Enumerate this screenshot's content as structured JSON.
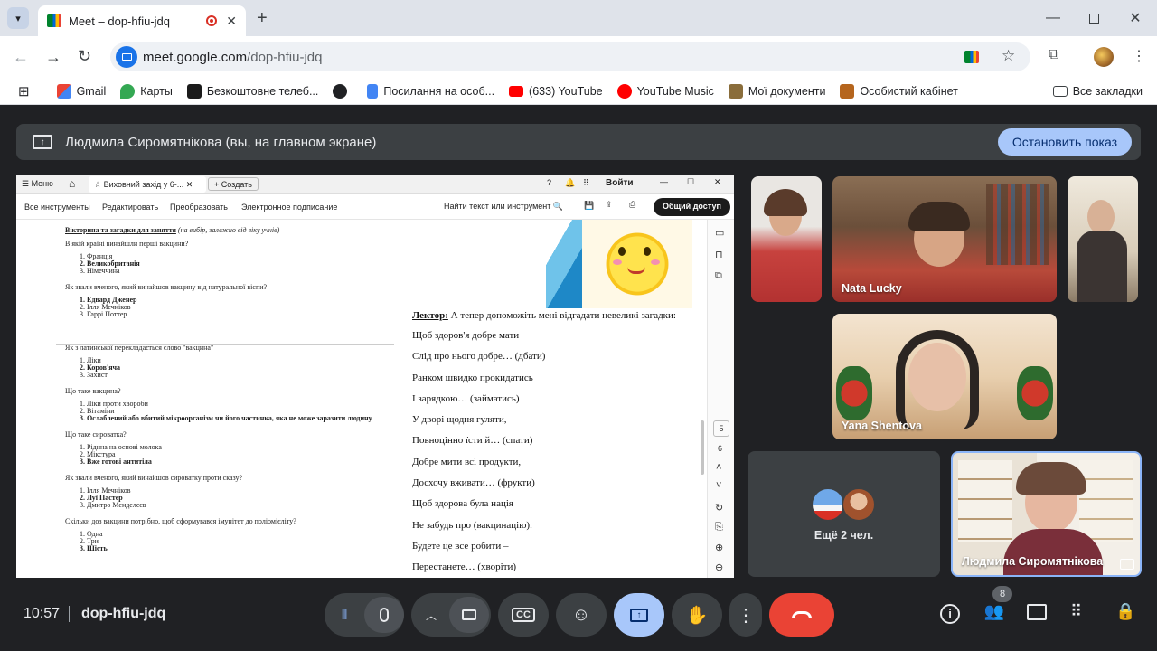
{
  "browser": {
    "tab_title": "Meet – dop-hfiu-jdq",
    "url_host": "meet.google.com",
    "url_path": "/dop-hfiu-jdq",
    "bookmarks": [
      "Gmail",
      "Карты",
      "Безкоштовне телеб...",
      "",
      "Посилання на особ...",
      "(633) YouTube",
      "YouTube Music",
      "Мої документи",
      "Особистий кабінет"
    ],
    "all_bookmarks": "Все закладки"
  },
  "presentation": {
    "label": "Людмила Сиромятнікова (вы, на главном экране)",
    "stop_button": "Остановить показ"
  },
  "doc_app": {
    "menu": "Меню",
    "tab": "Виховний захід у 6-...",
    "create": "Создать",
    "login": "Войти",
    "tools": [
      "Все инструменты",
      "Редактировать",
      "Преобразовать",
      "Электронное подписание"
    ],
    "find": "Найти текст или инструмент",
    "share": "Общий доступ",
    "page_nums": [
      "5",
      "6"
    ]
  },
  "doc_left": {
    "heading": "Вікторина та загадки для заняття",
    "heading_note": "(на вибір, залежно від віку учнів)",
    "blocks": [
      {
        "q": "В якій країні винайшли перші вакцини?",
        "a": [
          "1.  Франція",
          "2.  Великобританія",
          "3.  Німеччина"
        ]
      },
      {
        "q": "Як звали вченого, який винайшов вакцину від натуральної віспи?",
        "a": [
          "1.  Едвард Дженер",
          "2.  Ілля Мечніков",
          "3.  Гаррі Поттер"
        ]
      },
      {
        "q": "Як з латинської перекладається слово \"вакцина\"",
        "a": [
          "1.  Ліки",
          "2.  Коров'яча",
          "3.  Захист"
        ]
      },
      {
        "q": "Що таке вакцина?",
        "a": [
          "1.  Ліки проти хвороби",
          "2.  Вітаміни",
          "3.  Ослаблений або вбитий мікроорганізм чи його частинка, яка не може заразити людину"
        ]
      },
      {
        "q": "Що таке сироватка?",
        "a": [
          "1.  Рідина на основі молока",
          "2.  Мікстура",
          "3.  Вже готові антитіла"
        ]
      },
      {
        "q": "Як звали вченого, який винайшов сироватку проти сказу?",
        "a": [
          "1.  Ілля Мечніков",
          "2.  Луї Пастер",
          "3.  Дмитро Менделєєв"
        ]
      },
      {
        "q": "Скільки доз вакцини потрібно, щоб сформувався імунітет до поліомієліту?",
        "a": [
          "1.  Одна",
          "2.  Три",
          "3.  Шість"
        ]
      }
    ]
  },
  "doc_right": {
    "speaker": "Лектор:",
    "intro": "А тепер допоможіть мені відгадати невеликі загадки:",
    "lines": [
      "Щоб здоров'я добре мати",
      "Слід про нього добре… (дбати)",
      "Ранком швидко прокидатись",
      "І зарядкою… (займатись)",
      "У дворі щодня гуляти,",
      "Повноцінно їсти й… (спати)",
      "Добре мити всі продукти,",
      "Досхочу вживати… (фрукти)",
      "Щоб здорова була нація",
      "Не забудь про (вакцинацію).",
      "Будете це все робити –",
      "Перестанете… (хворіти)"
    ]
  },
  "participants": {
    "p1": "",
    "nata": "Nata Lucky",
    "p3": "",
    "yana": "Yana Shentova",
    "more": "Ещё 2 чел.",
    "self": "Людмила Сиромятнікова"
  },
  "bottom": {
    "time": "10:57",
    "code": "dop-hfiu-jdq",
    "people_count": "8"
  },
  "colors": {
    "meet_bg": "#202124",
    "hangup": "#ea4335",
    "present_active": "#a8c7fa"
  }
}
